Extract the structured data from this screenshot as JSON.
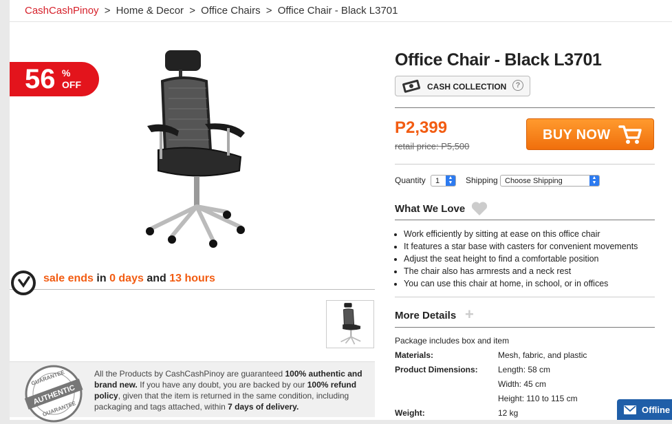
{
  "breadcrumb": {
    "home": "CashCashPinoy",
    "sep": ">",
    "items": [
      "Home & Decor",
      "Office Chairs",
      "Office Chair - Black L3701"
    ]
  },
  "badge": {
    "number": "56",
    "percent": "%",
    "off": "OFF"
  },
  "sale": {
    "part1": "sale ends",
    "part2": "in",
    "days": "0 days",
    "part3": "and",
    "hours": "13 hours"
  },
  "guarantee": {
    "seal_top": "GUARANTEE",
    "seal_mid": "AUTHENTIC",
    "seal_bottom": "GUARANTEE",
    "t1": "All the Products by CashCashPinoy are guaranteed ",
    "b1": "100% authentic and brand new.",
    "t2": " If you have any doubt, you are backed by our ",
    "b2": "100% refund policy",
    "t3": ", given that the item is returned in the same condition, including packaging and tags attached, within ",
    "b3": "7 days of delivery."
  },
  "product": {
    "title": "Office Chair - Black L3701",
    "cash_collection": "CASH COLLECTION",
    "help": "?",
    "price": "P2,399",
    "retail": "retail price: P5,500",
    "buy_now": "BUY NOW",
    "quantity_label": "Quantity",
    "quantity_value": "1",
    "shipping_label": "Shipping",
    "shipping_value": "Choose Shipping"
  },
  "love": {
    "heading": "What We Love",
    "items": [
      "Work efficiently by sitting at ease on this office chair",
      "It features a star base with casters for convenient movements",
      "Adjust the seat height to find a comfortable position",
      "The chair also has armrests and a neck rest",
      "You can use this chair at home, in school, or in offices"
    ]
  },
  "details": {
    "heading": "More Details",
    "plus": "+",
    "package": "Package includes box and item",
    "specs": [
      {
        "key": "Materials:",
        "value": "Mesh, fabric, and plastic"
      },
      {
        "key": "Product Dimensions:",
        "value": "Length: 58 cm"
      },
      {
        "key": "",
        "value": "Width: 45 cm"
      },
      {
        "key": "",
        "value": "Height: 110 to 115 cm"
      },
      {
        "key": "Weight:",
        "value": "12 kg"
      }
    ]
  },
  "chat": {
    "label": "Offline"
  },
  "colors": {
    "brand_red": "#e3141c",
    "price_orange": "#f25c12",
    "buy_orange": "#f47b14",
    "chat_blue": "#1f5ea8"
  }
}
